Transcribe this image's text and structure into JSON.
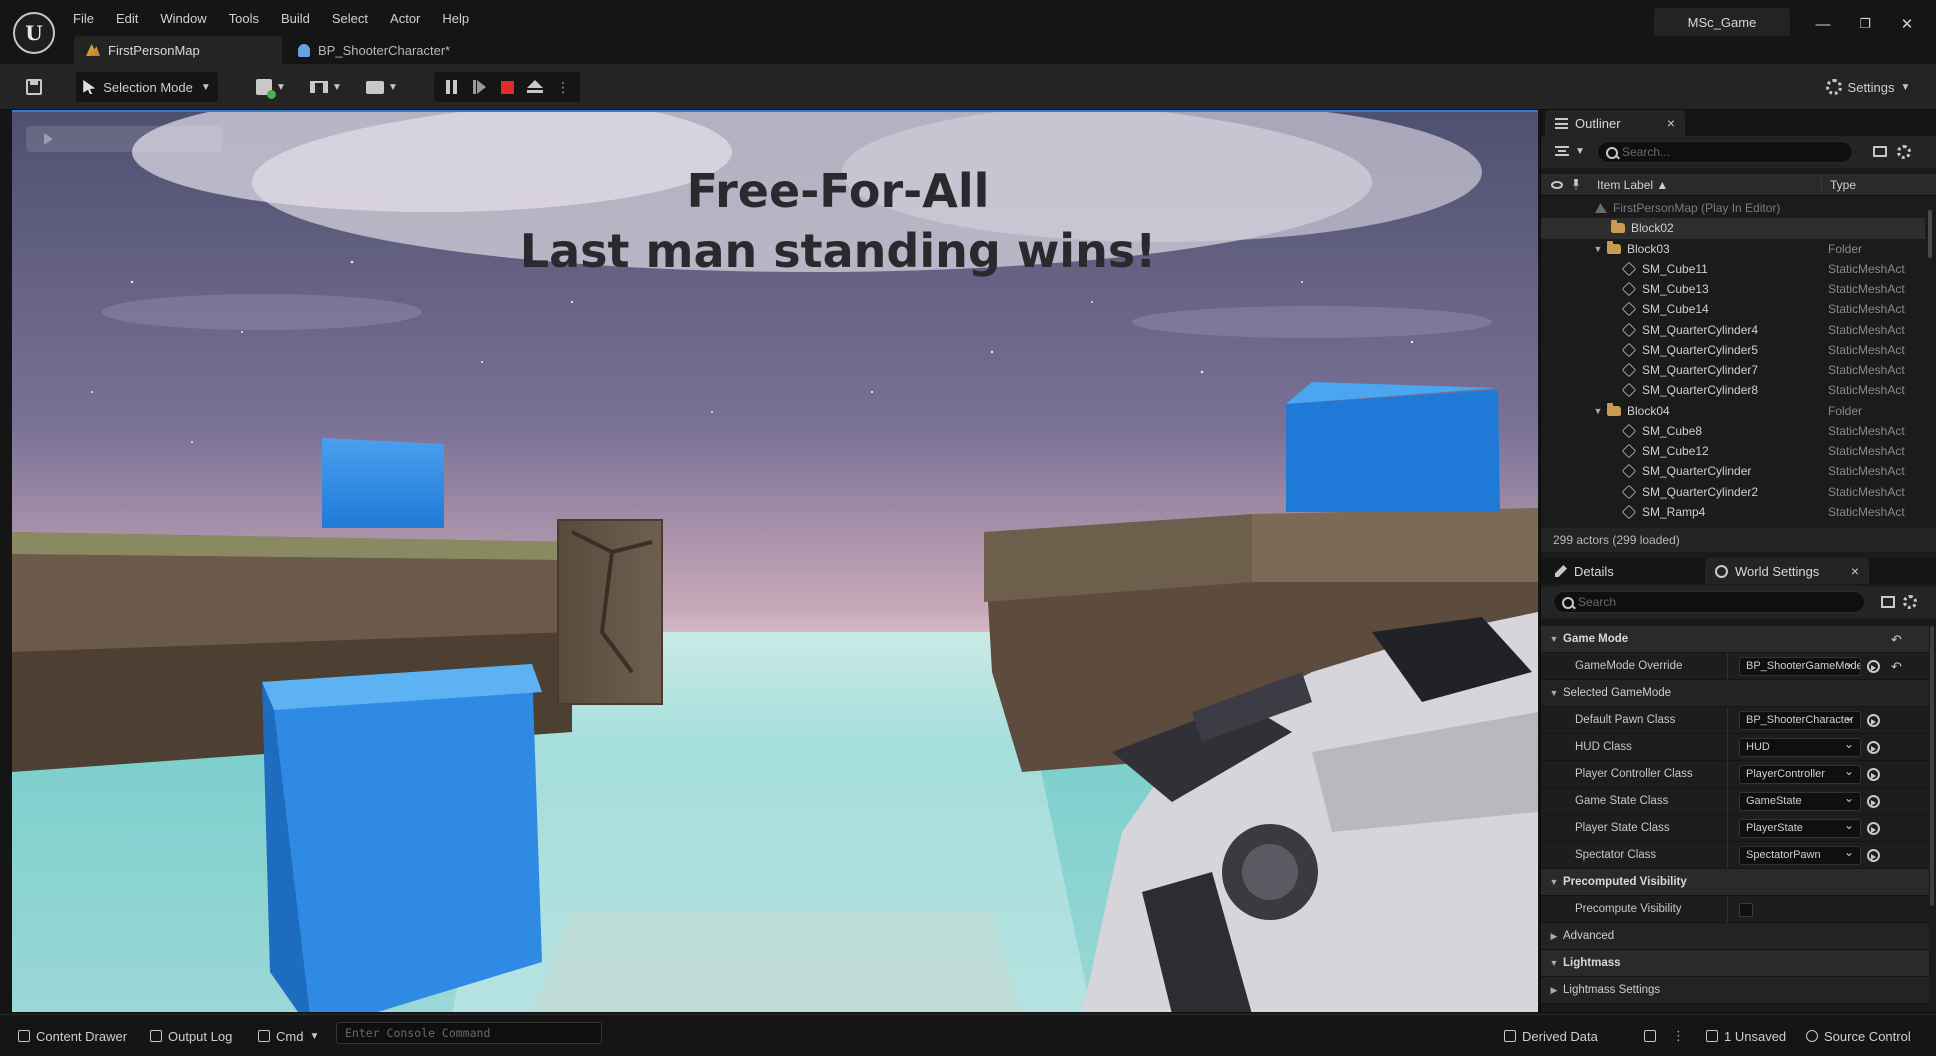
{
  "menu": [
    "File",
    "Edit",
    "Window",
    "Tools",
    "Build",
    "Select",
    "Actor",
    "Help"
  ],
  "tabs": [
    {
      "label": "FirstPersonMap",
      "active": true,
      "icon": "map-icon"
    },
    {
      "label": "BP_ShooterCharacter*",
      "active": false,
      "icon": "blueprint-icon"
    }
  ],
  "project_name": "MSc_Game",
  "window_controls": {
    "minimize": "—",
    "restore": "❐",
    "close": "✕"
  },
  "toolbar": {
    "mode_label": "Selection Mode",
    "settings_label": "Settings"
  },
  "viewport": {
    "hud_line1": "Free-For-All",
    "hud_line2": "Last man standing wins!"
  },
  "outliner": {
    "tab_label": "Outliner",
    "search_placeholder": "Search...",
    "col_label": "Item Label ▲",
    "col_type": "Type",
    "rows": [
      {
        "label": "FirstPersonMap (Play In Editor)",
        "type": "",
        "kind": "root",
        "indent": 54
      },
      {
        "label": "Block02",
        "type": "",
        "kind": "folder",
        "indent": 70,
        "selected": true
      },
      {
        "label": "Block03",
        "type": "Folder",
        "kind": "folder",
        "indent": 56,
        "expanded": true
      },
      {
        "label": "SM_Cube11",
        "type": "StaticMeshAct",
        "kind": "mesh",
        "indent": 82
      },
      {
        "label": "SM_Cube13",
        "type": "StaticMeshAct",
        "kind": "mesh",
        "indent": 82
      },
      {
        "label": "SM_Cube14",
        "type": "StaticMeshAct",
        "kind": "mesh",
        "indent": 82
      },
      {
        "label": "SM_QuarterCylinder4",
        "type": "StaticMeshAct",
        "kind": "mesh",
        "indent": 82
      },
      {
        "label": "SM_QuarterCylinder5",
        "type": "StaticMeshAct",
        "kind": "mesh",
        "indent": 82
      },
      {
        "label": "SM_QuarterCylinder7",
        "type": "StaticMeshAct",
        "kind": "mesh",
        "indent": 82
      },
      {
        "label": "SM_QuarterCylinder8",
        "type": "StaticMeshAct",
        "kind": "mesh",
        "indent": 82
      },
      {
        "label": "Block04",
        "type": "Folder",
        "kind": "folder",
        "indent": 56,
        "expanded": true
      },
      {
        "label": "SM_Cube8",
        "type": "StaticMeshAct",
        "kind": "mesh",
        "indent": 82
      },
      {
        "label": "SM_Cube12",
        "type": "StaticMeshAct",
        "kind": "mesh",
        "indent": 82
      },
      {
        "label": "SM_QuarterCylinder",
        "type": "StaticMeshAct",
        "kind": "mesh",
        "indent": 82
      },
      {
        "label": "SM_QuarterCylinder2",
        "type": "StaticMeshAct",
        "kind": "mesh",
        "indent": 82
      },
      {
        "label": "SM_Ramp4",
        "type": "StaticMeshAct",
        "kind": "mesh",
        "indent": 82
      }
    ],
    "footer": "299 actors (299 loaded)"
  },
  "details": {
    "tab_details": "Details",
    "tab_world_settings": "World Settings",
    "search_placeholder": "Search",
    "rows": [
      {
        "kind": "category",
        "label": "Game Mode",
        "expanded": true
      },
      {
        "kind": "prop",
        "label": "GameMode Override",
        "value": "BP_ShooterGameMode",
        "use": true,
        "reset": true
      },
      {
        "kind": "subcategory",
        "label": "Selected GameMode",
        "expanded": true
      },
      {
        "kind": "prop",
        "label": "Default Pawn Class",
        "value": "BP_ShooterCharacter",
        "use": true
      },
      {
        "kind": "prop",
        "label": "HUD Class",
        "value": "HUD",
        "use": true
      },
      {
        "kind": "prop",
        "label": "Player Controller Class",
        "value": "PlayerController",
        "use": true
      },
      {
        "kind": "prop",
        "label": "Game State Class",
        "value": "GameState",
        "use": true
      },
      {
        "kind": "prop",
        "label": "Player State Class",
        "value": "PlayerState",
        "use": true
      },
      {
        "kind": "prop",
        "label": "Spectator Class",
        "value": "SpectatorPawn",
        "use": true
      },
      {
        "kind": "category",
        "label": "Precomputed Visibility",
        "expanded": true
      },
      {
        "kind": "check",
        "label": "Precompute Visibility",
        "checked": false
      },
      {
        "kind": "subcategory",
        "label": "Advanced",
        "expanded": false
      },
      {
        "kind": "category",
        "label": "Lightmass",
        "expanded": true
      },
      {
        "kind": "subcategory",
        "label": "Lightmass Settings",
        "expanded": false,
        "reset": true
      }
    ]
  },
  "statusbar": {
    "content_drawer": "Content Drawer",
    "output_log": "Output Log",
    "cmd": "Cmd",
    "console_placeholder": "Enter Console Command",
    "derived_data": "Derived Data",
    "unsaved": "1 Unsaved",
    "source_control": "Source Control"
  },
  "colors": {
    "accent": "#2a7fd6",
    "stop": "#e02b2b",
    "folder": "#c89a52"
  }
}
